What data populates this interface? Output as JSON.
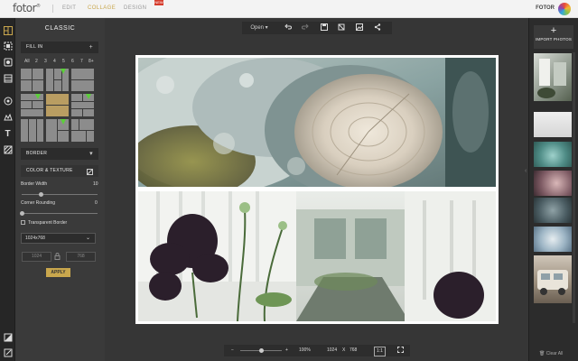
{
  "topbar": {
    "logo": "fotor",
    "nav": [
      "EDIT",
      "COLLAGE",
      "DESIGN"
    ],
    "active_nav": "COLLAGE",
    "new_badge": "NEW",
    "brand": "FOTOR"
  },
  "sidebar_icons": [
    "template-icon",
    "freestyle-icon",
    "sticker-icon",
    "background-icon",
    "layers-icon",
    "stamp-icon",
    "text-icon",
    "texture-icon",
    "expand-icon",
    "edit-icon"
  ],
  "panel": {
    "title": "CLASSIC",
    "fill_in": {
      "label": "FILL IN",
      "add": "+"
    },
    "counts": [
      "All",
      "2",
      "3",
      "4",
      "5",
      "6",
      "7",
      "8+"
    ],
    "border": {
      "label": "BORDER",
      "chevron": "▾"
    },
    "color_texture": {
      "label": "COLOR & TEXTURE"
    },
    "border_width": {
      "label": "Border Width",
      "value": "10",
      "fraction": 0.25
    },
    "corner_rounding": {
      "label": "Corner Rounding",
      "value": "0",
      "fraction": 0.0
    },
    "transparent_border": {
      "label": "Transparent Border",
      "checked": false
    },
    "size_select": "1024x768",
    "width": "1024",
    "height": "768",
    "apply": "APPLY"
  },
  "toolbar": {
    "open_label": "Open",
    "open_chevron": "▾",
    "icons": [
      "undo-icon",
      "redo-icon",
      "save-icon",
      "crop-icon",
      "image-icon",
      "share-icon"
    ]
  },
  "bottombar": {
    "minus": "−",
    "plus": "+",
    "zoom": "100%",
    "width": "1024",
    "x": "X",
    "height": "768",
    "fit": "1:1",
    "zoom_fraction": 0.5
  },
  "right": {
    "import_plus": "+",
    "import_label": "IMPORT PHOTOS",
    "clear_all": "Clear All"
  },
  "colors": {
    "accent": "#c9a74d",
    "check": "#5ccf3a",
    "panel": "#3a3a3a",
    "workspace": "#363636"
  }
}
